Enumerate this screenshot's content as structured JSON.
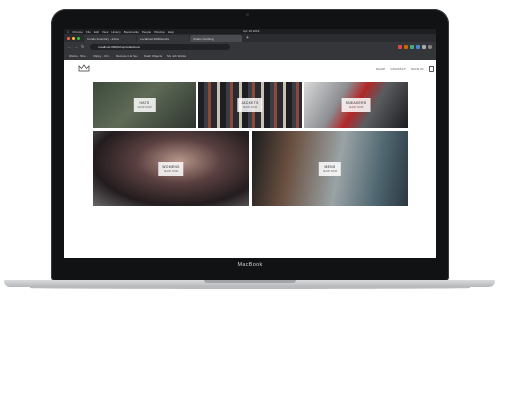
{
  "device": {
    "brand": "MacBook"
  },
  "menubar": {
    "items": [
      "",
      "Chrome",
      "File",
      "Edit",
      "View",
      "History",
      "Bookmarks",
      "People",
      "Window",
      "Help"
    ],
    "clock": "Apr 19 2019"
  },
  "browser": {
    "tabs": [
      {
        "label": "Condo Inventory - Inbox"
      },
      {
        "label": "Localhost:3000/works"
      },
      {
        "label": "Charis Clothing"
      }
    ],
    "url": "localhost:3000/shop/collections",
    "bookmarks": [
      "Works - Sho...",
      "Clippy - CO...",
      "Remote it at Sa...",
      "Dash Objects",
      "My Job Works"
    ]
  },
  "site": {
    "nav": [
      "SHOP",
      "CONTACT",
      "SIGN IN"
    ],
    "categories": [
      {
        "title": "HATS",
        "cta": "SHOP NOW",
        "color": "#4a5a4a"
      },
      {
        "title": "JACKETS",
        "cta": "SHOP NOW",
        "color": "#2a2a2e"
      },
      {
        "title": "SNEAKERS",
        "cta": "SHOP NOW",
        "color": "#7a7c80"
      },
      {
        "title": "WOMENS",
        "cta": "SHOP NOW",
        "color": "#6f6060"
      },
      {
        "title": "MENS",
        "cta": "SHOP NOW",
        "color": "#5b6a70"
      }
    ]
  },
  "colors": {
    "accent": "#e2e2e2",
    "chrome": "#2b2c2f",
    "bezel": "#111214"
  }
}
